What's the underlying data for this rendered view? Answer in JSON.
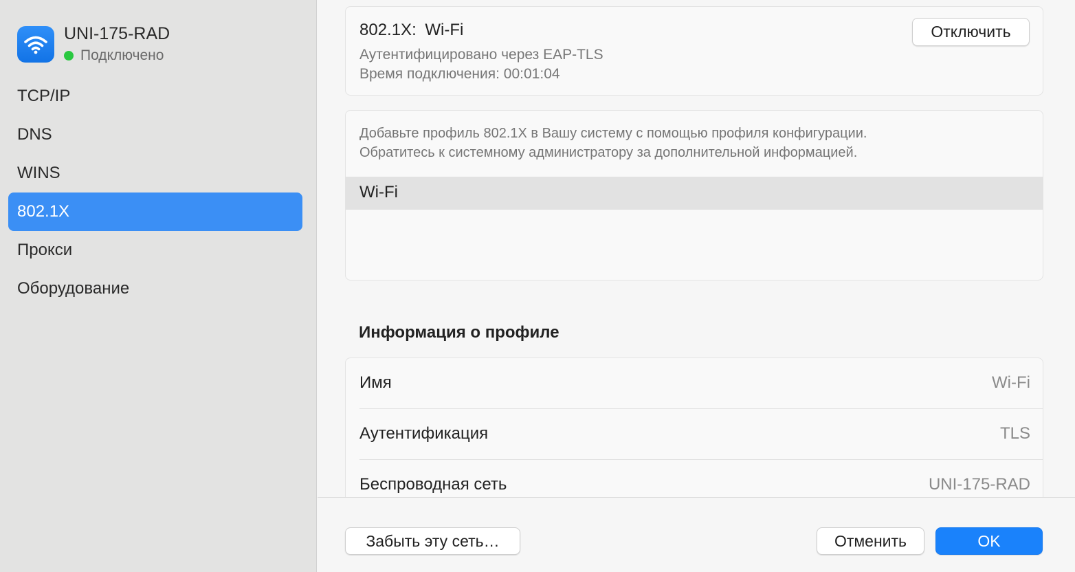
{
  "sidebar": {
    "network": {
      "name": "UNI-175-RAD",
      "status": "Подключено",
      "status_color": "#2ac840",
      "icon": "wifi-icon"
    },
    "items": [
      {
        "label": "TCP/IP",
        "active": false
      },
      {
        "label": "DNS",
        "active": false
      },
      {
        "label": "WINS",
        "active": false
      },
      {
        "label": "802.1X",
        "active": true
      },
      {
        "label": "Прокси",
        "active": false
      },
      {
        "label": "Оборудование",
        "active": false
      }
    ],
    "accent": "#3b8ff5"
  },
  "connection": {
    "title": "802.1X:  Wi-Fi",
    "auth_line": "Аутентифицировано через EAP-TLS",
    "time_line": "Время подключения: 00:01:04",
    "disconnect_label": "Отключить"
  },
  "profiles": {
    "info_line1": "Добавьте профиль 802.1X в Вашу систему с помощью профиля конфигурации.",
    "info_line2": "Обратитесь к системному администратору за дополнительной информацией.",
    "items": [
      "Wi-Fi"
    ]
  },
  "profile_info": {
    "title": "Информация о профиле",
    "rows": [
      {
        "key": "Имя",
        "value": "Wi-Fi"
      },
      {
        "key": "Аутентификация",
        "value": "TLS"
      },
      {
        "key": "Беспроводная сеть",
        "value": "UNI-175-RAD"
      }
    ]
  },
  "footer": {
    "forget_label": "Забыть эту сеть…",
    "cancel_label": "Отменить",
    "ok_label": "OK",
    "ok_color": "#1a82fb"
  }
}
